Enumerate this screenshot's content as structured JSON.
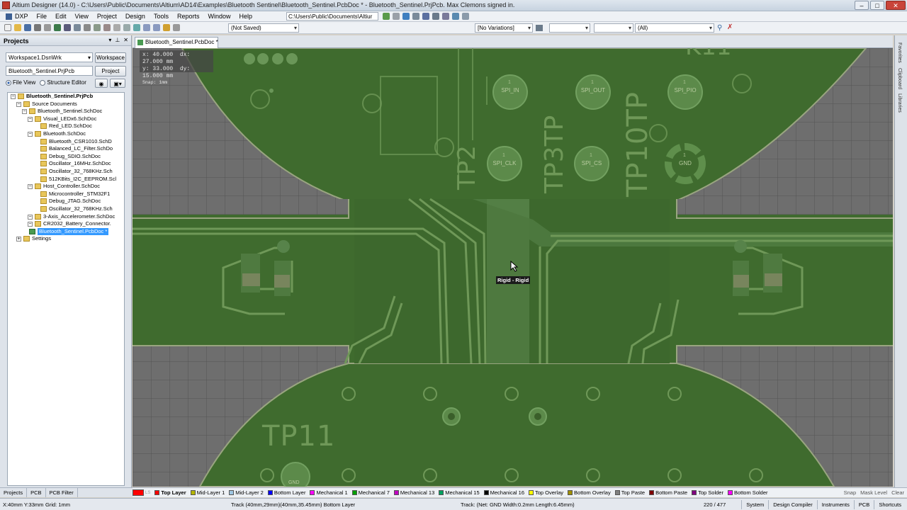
{
  "window": {
    "title": "Altium Designer (14.0) - C:\\Users\\Public\\Documents\\Altium\\AD14\\Examples\\Bluetooth Sentinel\\Bluetooth_Sentinel.PcbDoc * - Bluetooth_Sentinel.PrjPcb. Max Clemons signed in."
  },
  "menu": {
    "items": [
      "DXP",
      "File",
      "Edit",
      "View",
      "Project",
      "Design",
      "Tools",
      "Reports",
      "Window",
      "Help"
    ],
    "path": "C:\\Users\\Public\\Documents\\Altiur"
  },
  "toolbar": {
    "saved_state": "(Not Saved)",
    "variations": "[No Variations]",
    "filter": "(All)"
  },
  "projects_panel": {
    "title": "Projects",
    "workspace": "Workspace1.DsnWrk",
    "workspace_button": "Workspace",
    "project": "Bluetooth_Sentinel.PrjPcb",
    "project_button": "Project",
    "file_view": "File View",
    "structure_editor": "Structure Editor",
    "tree": [
      {
        "label": "Bluetooth_Sentinel.PrjPcb",
        "level": 0,
        "type": "proj",
        "bold": true
      },
      {
        "label": "Source Documents",
        "level": 1,
        "type": "folder"
      },
      {
        "label": "Bluetooth_Sentinel.SchDoc",
        "level": 2,
        "type": "folder"
      },
      {
        "label": "Visual_LEDx6.SchDoc",
        "level": 3,
        "type": "folder"
      },
      {
        "label": "Red_LED.SchDoc",
        "level": 4,
        "type": "folder"
      },
      {
        "label": "Bluetooth.SchDoc",
        "level": 3,
        "type": "folder"
      },
      {
        "label": "Bluetooth_CSR1010.SchD",
        "level": 4,
        "type": "folder"
      },
      {
        "label": "Balanced_LC_Filter.SchDo",
        "level": 4,
        "type": "folder"
      },
      {
        "label": "Debug_SDIO.SchDoc",
        "level": 4,
        "type": "folder"
      },
      {
        "label": "Oscillator_16MHz.SchDoc",
        "level": 4,
        "type": "folder"
      },
      {
        "label": "Oscillator_32_768KHz.Sch",
        "level": 4,
        "type": "folder"
      },
      {
        "label": "512KBits_I2C_EEPROM.Scl",
        "level": 4,
        "type": "folder"
      },
      {
        "label": "Host_Controller.SchDoc",
        "level": 3,
        "type": "folder"
      },
      {
        "label": "Microcontroller_STM32F1",
        "level": 4,
        "type": "folder"
      },
      {
        "label": "Debug_JTAG.SchDoc",
        "level": 4,
        "type": "folder"
      },
      {
        "label": "Oscillator_32_768KHz.Sch",
        "level": 4,
        "type": "folder"
      },
      {
        "label": "3-Axis_Accelerometer.SchDoc",
        "level": 3,
        "type": "folder"
      },
      {
        "label": "CR2032_Battery_Connector.",
        "level": 3,
        "type": "folder"
      },
      {
        "label": "Bluetooth_Sentinel.PcbDoc *",
        "level": 2,
        "type": "pcb",
        "selected": true
      },
      {
        "label": "Settings",
        "level": 1,
        "type": "folder"
      }
    ]
  },
  "document_tab": "Bluetooth_Sentinel.PcbDoc *",
  "coords": {
    "x": "x: 40.000",
    "dx": "dx: 27.000  mm",
    "y": "y: 33.000",
    "dy": "dy: 15.000  mm",
    "snap": "Snap: 1mm"
  },
  "pcb_labels": {
    "tooltip": "Rigid - Rigid",
    "tp11": "TP11",
    "tp10": "TP10TP",
    "tp2": "TP2",
    "tp3": "TP3TP",
    "k11": "K11",
    "pads": [
      "SPI_IN",
      "SPI_OUT",
      "SPI_PIO",
      "SPI_CLK",
      "SPI_CS",
      "GND",
      "GND"
    ],
    "pad_number": "1"
  },
  "right_panels": [
    "Favorites",
    "Clipboard",
    "Libraries"
  ],
  "bottom_tabs": [
    "Projects",
    "PCB",
    "PCB Filter"
  ],
  "layers": [
    {
      "name": "LS",
      "color": "#ff0000"
    },
    {
      "name": "Top Layer",
      "color": "#ff0000",
      "active": true
    },
    {
      "name": "Mid-Layer 1",
      "color": "#b5b500"
    },
    {
      "name": "Mid-Layer 2",
      "color": "#9ec6e2"
    },
    {
      "name": "Bottom Layer",
      "color": "#0000ff"
    },
    {
      "name": "Mechanical 1",
      "color": "#ff00ff"
    },
    {
      "name": "Mechanical 7",
      "color": "#00a000"
    },
    {
      "name": "Mechanical 13",
      "color": "#c000c0"
    },
    {
      "name": "Mechanical 15",
      "color": "#00a060"
    },
    {
      "name": "Mechanical 16",
      "color": "#000000"
    },
    {
      "name": "Top Overlay",
      "color": "#ffff00"
    },
    {
      "name": "Bottom Overlay",
      "color": "#a09000"
    },
    {
      "name": "Top Paste",
      "color": "#808080"
    },
    {
      "name": "Bottom Paste",
      "color": "#800000"
    },
    {
      "name": "Top Solder",
      "color": "#800080"
    },
    {
      "name": "Bottom Solder",
      "color": "#ff00ff"
    }
  ],
  "layer_tail": [
    "Snap",
    "Mask Level",
    "Clear"
  ],
  "status": {
    "cursor": "X:40mm Y:33mm",
    "grid": "Grid: 1mm",
    "track": "Track (40mm,29mm)(40mm,35.45mm) Bottom Layer",
    "track_info": "Track: (Net: GND Width:0.2mm Length:6.45mm)",
    "count": "220 / 477",
    "tabs": [
      "System",
      "Design Compiler",
      "Instruments",
      "PCB",
      "Shortcuts"
    ]
  }
}
